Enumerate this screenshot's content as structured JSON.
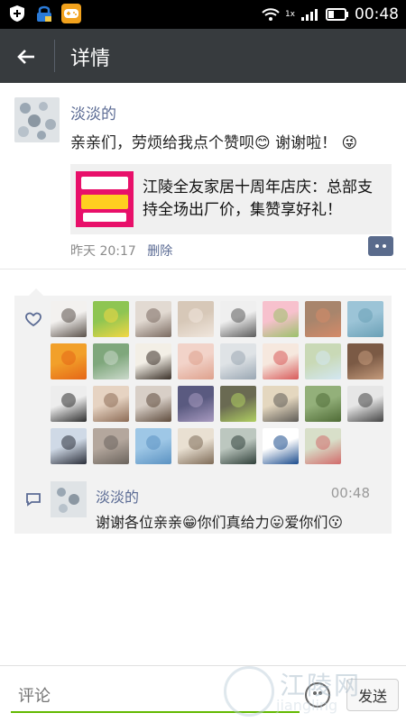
{
  "status": {
    "time": "00:48",
    "net": "1x"
  },
  "header": {
    "title": "详情"
  },
  "post": {
    "author": "淡淡的",
    "text": "亲亲们，劳烦给我点个赞呗😊 谢谢啦！ 😜",
    "link_card": {
      "text": "江陵全友家居十周年店庆：总部支持全场出厂价，集赞享好礼！"
    },
    "meta_time": "昨天 20:17",
    "delete_label": "删除"
  },
  "likes": {
    "avatars": [
      {
        "c1": "#f3f1ef",
        "c2": "#5a514a"
      },
      {
        "c1": "#8ec552",
        "c2": "#f3d743"
      },
      {
        "c1": "#e2dad2",
        "c2": "#7a6a60"
      },
      {
        "c1": "#d7c8b8",
        "c2": "#f0e6dd"
      },
      {
        "c1": "#efefef",
        "c2": "#5b5b5b"
      },
      {
        "c1": "#f7c1cd",
        "c2": "#9bc16a"
      },
      {
        "c1": "#a8856c",
        "c2": "#d58a68"
      },
      {
        "c1": "#9cc4d7",
        "c2": "#6aa0b6"
      },
      {
        "c1": "#f2a02a",
        "c2": "#e56616"
      },
      {
        "c1": "#7fa77c",
        "c2": "#cbd9cb"
      },
      {
        "c1": "#f3efe6",
        "c2": "#3a3028"
      },
      {
        "c1": "#f2d3c9",
        "c2": "#dea18d"
      },
      {
        "c1": "#dfe3e6",
        "c2": "#9aa7b3"
      },
      {
        "c1": "#f6e8de",
        "c2": "#d85a5a"
      },
      {
        "c1": "#c9d9b6",
        "c2": "#d3e7f2"
      },
      {
        "c1": "#7b5a45",
        "c2": "#c49a7b"
      },
      {
        "c1": "#ededed",
        "c2": "#2f2f2f"
      },
      {
        "c1": "#e6d3c2",
        "c2": "#8c6b55"
      },
      {
        "c1": "#d8cfc7",
        "c2": "#5e4b3c"
      },
      {
        "c1": "#5a5a80",
        "c2": "#a89ac0"
      },
      {
        "c1": "#6a6a52",
        "c2": "#b0cf61"
      },
      {
        "c1": "#e4d7bf",
        "c2": "#5e5b56"
      },
      {
        "c1": "#93b07a",
        "c2": "#4f6b36"
      },
      {
        "c1": "#e6e6e6",
        "c2": "#444"
      },
      {
        "c1": "#cfd9e6",
        "c2": "#2b2f3a"
      },
      {
        "c1": "#b4a79d",
        "c2": "#6a635c"
      },
      {
        "c1": "#9ec7e6",
        "c2": "#5b92c2"
      },
      {
        "c1": "#e9e0d2",
        "c2": "#7e6b57"
      },
      {
        "c1": "#bcc7bf",
        "c2": "#30403a"
      },
      {
        "c1": "#ffffff",
        "c2": "#1b4c8d"
      },
      {
        "c1": "#d8dfc9",
        "c2": "#d26b6b"
      }
    ]
  },
  "comment": {
    "author": "淡淡的",
    "time": "00:48",
    "text": "谢谢各位亲亲😁你们真给力😛爱你们😗"
  },
  "input": {
    "placeholder": "评论",
    "send_label": "发送"
  },
  "watermark": {
    "main": "江陵网",
    "sub": "jiangling"
  },
  "colors": {
    "accent_link": "#5b6b94",
    "topbar": "#373b3e",
    "input_underline": "#62b900"
  }
}
